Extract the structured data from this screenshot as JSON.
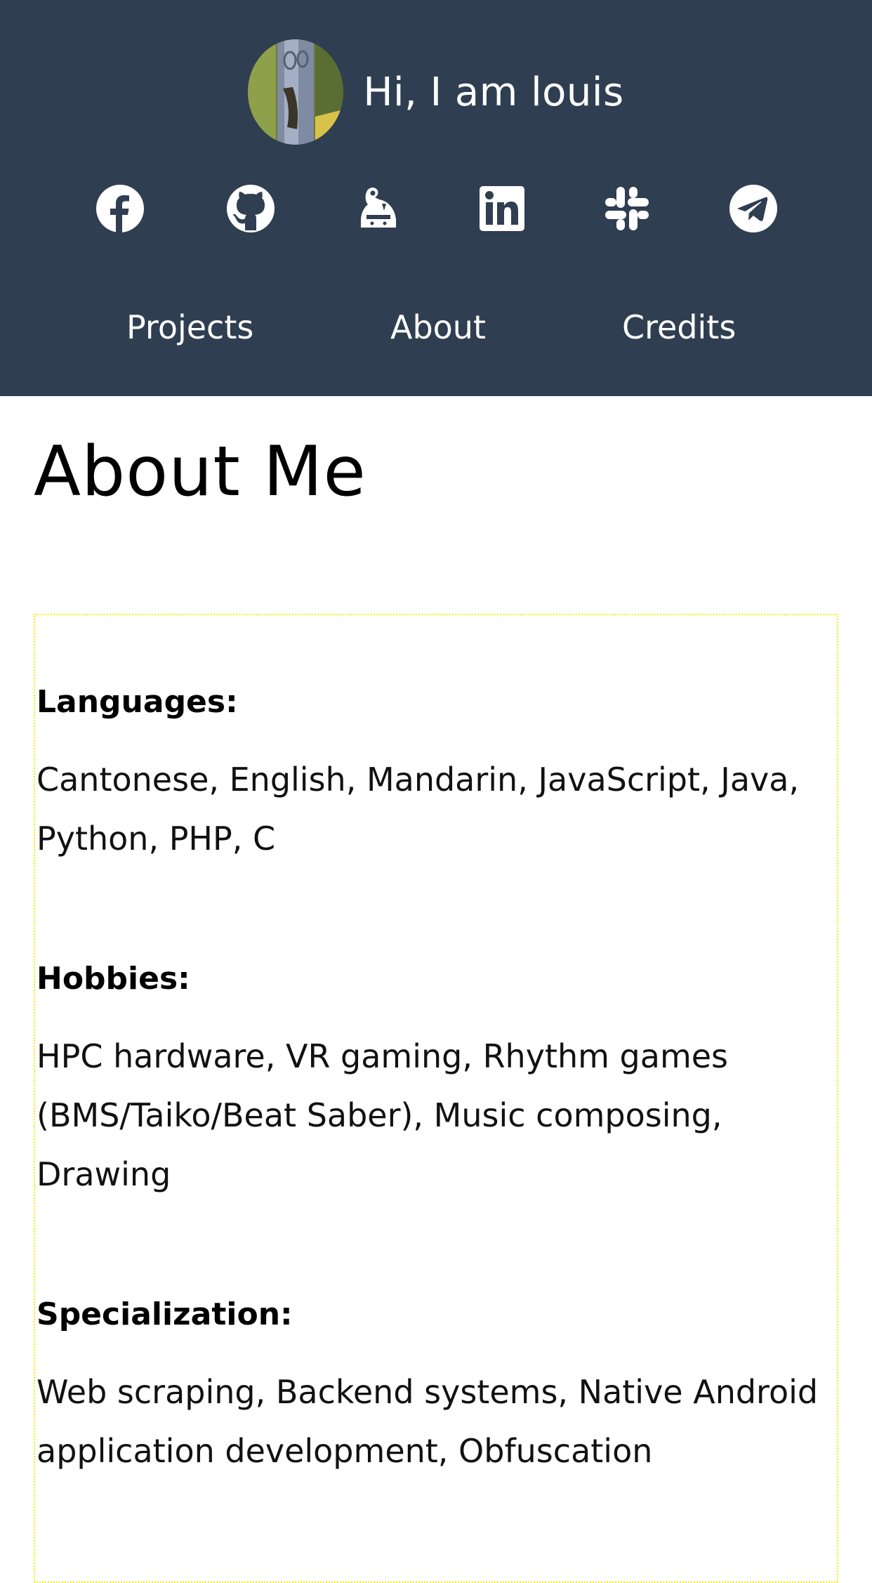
{
  "header": {
    "greeting": "Hi, I am louis",
    "avatar_alt": "profile photo",
    "social_links": [
      {
        "name": "facebook",
        "icon": "facebook-icon"
      },
      {
        "name": "github",
        "icon": "github-icon"
      },
      {
        "name": "discord-bot",
        "icon": "bot-icon"
      },
      {
        "name": "linkedin",
        "icon": "linkedin-icon"
      },
      {
        "name": "slack",
        "icon": "slack-icon"
      },
      {
        "name": "telegram",
        "icon": "telegram-icon"
      }
    ],
    "nav": [
      {
        "label": "Projects"
      },
      {
        "label": "About"
      },
      {
        "label": "Credits"
      }
    ],
    "background_color": "#2f3e51"
  },
  "main": {
    "title": "About Me",
    "sections": [
      {
        "heading": "Languages:",
        "text": "Cantonese, English, Mandarin, JavaScript, Java, Python, PHP, C"
      },
      {
        "heading": "Hobbies:",
        "text": "HPC hardware, VR gaming, Rhythm games (BMS/Taiko/Beat Saber), Music composing, Drawing"
      },
      {
        "heading": "Specialization:",
        "text": "Web scraping, Backend systems, Native Android application development, Obfuscation"
      }
    ],
    "box_border_color": "#f2f200"
  }
}
